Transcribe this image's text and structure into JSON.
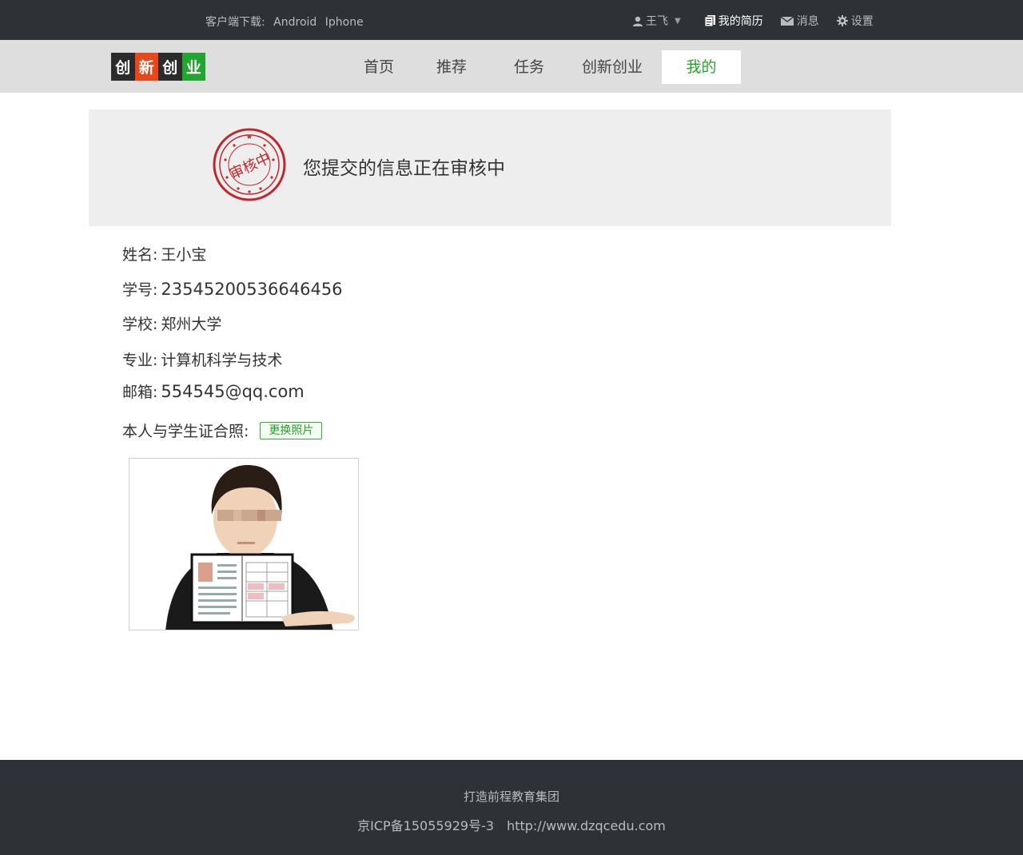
{
  "topbar": {
    "download_label": "客户端下载:",
    "android": "Android",
    "iphone": "Iphone",
    "user_name": "王飞",
    "resume": "我的简历",
    "messages": "消息",
    "settings": "设置"
  },
  "logo": {
    "chars": [
      "创",
      "新",
      "创",
      "业"
    ],
    "colors": [
      "#2b2b2b",
      "#e8471c",
      "#2b2b2b",
      "#23a532"
    ]
  },
  "nav": {
    "home": "首页",
    "recommend": "推荐",
    "tasks": "任务",
    "innovation": "创新创业",
    "mine": "我的"
  },
  "status": {
    "stamp_text": "审核中",
    "message": "您提交的信息正在审核中"
  },
  "info": {
    "name_label": "姓名:",
    "name": "王小宝",
    "id_label": "学号:",
    "id": "23545200536646456",
    "school_label": "学校:",
    "school": "郑州大学",
    "major_label": "专业:",
    "major": "计算机科学与技术",
    "email_label": "邮箱:",
    "email": "554545@qq.com",
    "photo_label": "本人与学生证合照:",
    "change_photo": "更换照片"
  },
  "footer": {
    "slogan": "打造前程教育集团",
    "icp": "京ICP备15055929号-3",
    "url": "http://www.dzqcedu.com"
  },
  "colors": {
    "dark": "#2e3236",
    "accent": "#2aa52a",
    "stamp": "#c0282d"
  }
}
